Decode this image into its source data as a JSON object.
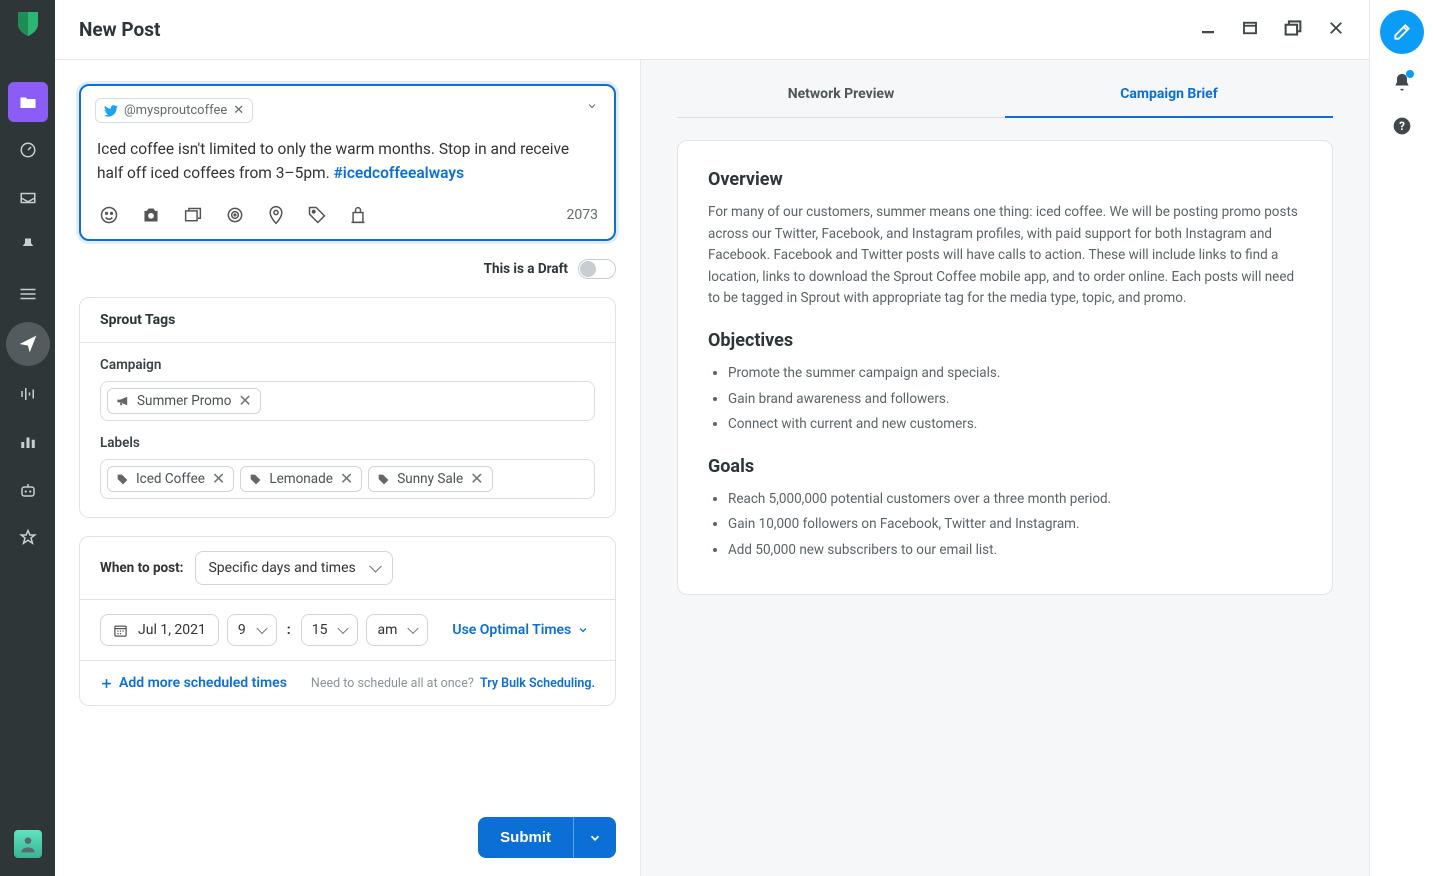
{
  "header": {
    "title": "New Post"
  },
  "composer": {
    "account_handle": "@mysproutcoffee",
    "text_plain": "Iced coffee isn't limited to only the warm months. Stop in and receive half off iced coffees from 3–5pm. ",
    "hashtag": "#icedcoffeealways",
    "char_count": "2073"
  },
  "draft": {
    "label": "This is a Draft"
  },
  "tags": {
    "section_title": "Sprout Tags",
    "campaign_label": "Campaign",
    "campaign_value": "Summer Promo",
    "labels_label": "Labels",
    "labels": [
      "Iced Coffee",
      "Lemonade",
      "Sunny Sale"
    ]
  },
  "schedule": {
    "when_label": "When to post:",
    "when_value": "Specific days and times",
    "date": "Jul 1, 2021",
    "hour": "9",
    "minute": "15",
    "ampm": "am",
    "optimal_link": "Use Optimal Times",
    "add_more": "Add more scheduled times",
    "bulk_prompt": "Need to schedule all at once?",
    "bulk_link": "Try Bulk Scheduling."
  },
  "submit": {
    "label": "Submit"
  },
  "preview": {
    "tab_network": "Network Preview",
    "tab_brief": "Campaign Brief",
    "overview_h": "Overview",
    "overview_p": "For many of our customers, summer means one thing: iced coffee. We will be posting promo posts across our Twitter, Facebook, and Instagram profiles, with paid support for both Instagram and Facebook. Facebook and Twitter posts will have calls to action. These will include links to find a location, links to download the Sprout Coffee mobile app, and to order online. Each posts will need to be tagged in Sprout with appropriate tag for the media type, topic, and promo.",
    "objectives_h": "Objectives",
    "objectives": [
      "Promote the summer campaign and specials.",
      "Gain brand awareness and followers.",
      "Connect with current and new customers."
    ],
    "goals_h": "Goals",
    "goals": [
      "Reach 5,000,000 potential customers over a three month period.",
      "Gain 10,000 followers on Facebook, Twitter and Instagram.",
      "Add 50,000 new subscribers to our email list."
    ]
  }
}
